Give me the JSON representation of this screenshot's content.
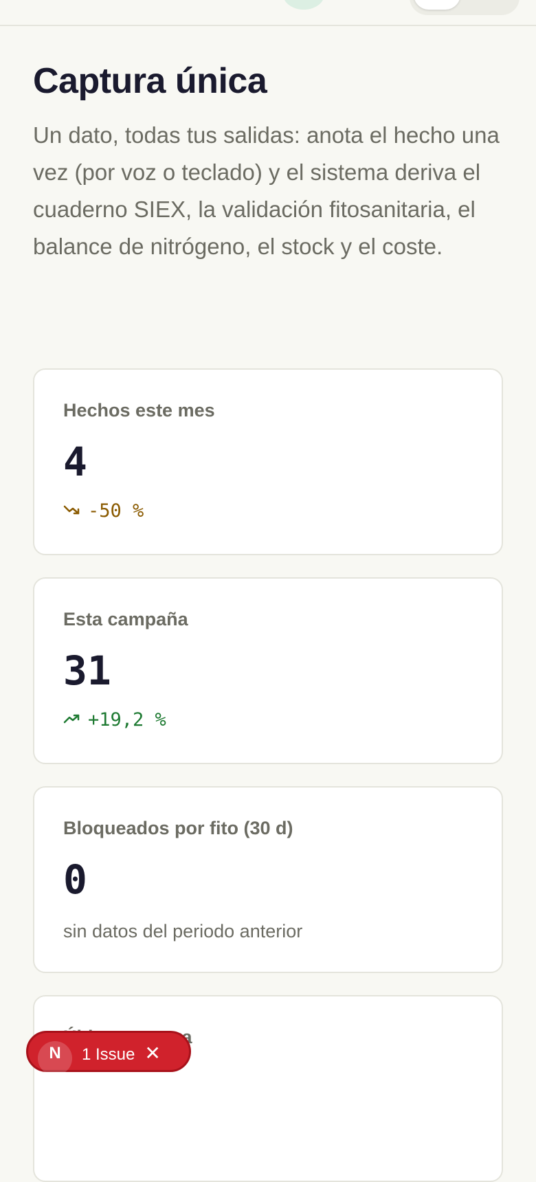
{
  "header": {
    "title": "Captura única",
    "description": "Un dato, todas tus salidas: anota el hecho una vez (por voz o teclado) y el sistema deriva el cuaderno SIEX, la validación fitosanitaria, el balance de nitrógeno, el stock y el coste."
  },
  "stats": [
    {
      "label": "Hechos este mes",
      "value": "4",
      "trend": "-50 %",
      "trend_direction": "down",
      "trend_color": "#8a5a00"
    },
    {
      "label": "Esta campaña",
      "value": "31",
      "trend": "+19,2 %",
      "trend_direction": "up",
      "trend_color": "#1e7a32"
    },
    {
      "label": "Bloqueados por fito (30 d)",
      "value": "0",
      "note": "sin datos del periodo anterior"
    },
    {
      "label": "Última captura"
    }
  ],
  "dev_overlay": {
    "letter": "N",
    "issues_label": "1 Issue",
    "close_icon": "close-icon",
    "color": "#d0222c"
  }
}
